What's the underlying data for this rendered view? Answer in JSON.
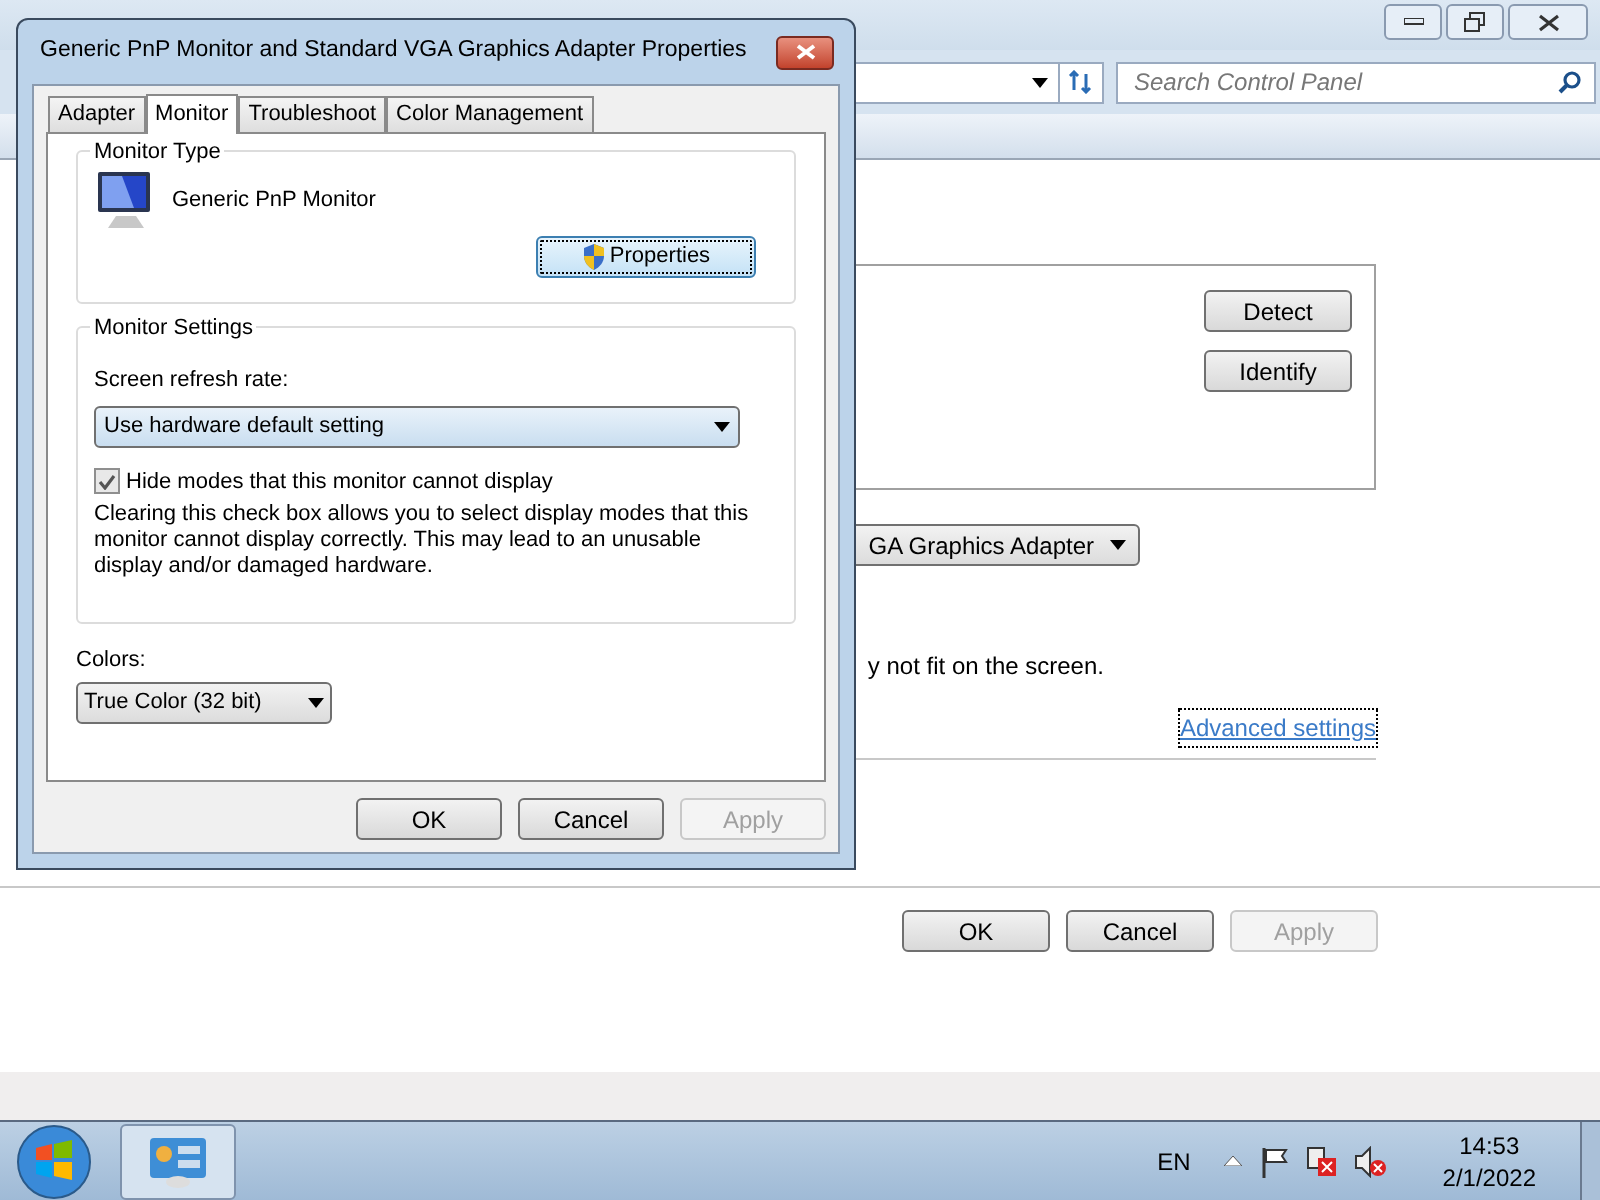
{
  "background_window": {
    "search": {
      "placeholder": "Search Control Panel"
    },
    "detect_button": {
      "label": "Detect"
    },
    "identify_button": {
      "label": "Identify"
    },
    "display_dropdown": {
      "value": "GA Graphics Adapter"
    },
    "note": "y not fit on the screen.",
    "advanced_link": "Advanced settings",
    "buttons": [
      {
        "label": "OK",
        "disabled": false
      },
      {
        "label": "Cancel",
        "disabled": false
      },
      {
        "label": "Apply",
        "disabled": true
      }
    ]
  },
  "dialog": {
    "title": "Generic PnP Monitor and Standard VGA Graphics Adapter Properties",
    "tabs": [
      {
        "label": "Adapter",
        "selected": false
      },
      {
        "label": "Monitor",
        "selected": true
      },
      {
        "label": "Troubleshoot",
        "selected": false
      },
      {
        "label": "Color Management",
        "selected": false
      }
    ],
    "monitor_type": {
      "legend": "Monitor Type",
      "name": "Generic PnP Monitor",
      "properties_button": "Properties"
    },
    "monitor_settings": {
      "legend": "Monitor Settings",
      "refresh_label": "Screen refresh rate:",
      "refresh_value": "Use hardware default setting",
      "hide_modes": {
        "label": "Hide modes that this monitor cannot display",
        "checked": true
      },
      "description": "Clearing this check box allows you to select display modes that this monitor cannot display correctly. This may lead to an unusable display and/or damaged hardware."
    },
    "colors": {
      "label": "Colors:",
      "value": "True Color (32 bit)"
    },
    "buttons": [
      {
        "label": "OK",
        "disabled": false
      },
      {
        "label": "Cancel",
        "disabled": false
      },
      {
        "label": "Apply",
        "disabled": true
      }
    ]
  },
  "taskbar": {
    "language": "EN",
    "time": "14:53",
    "date": "2/1/2022"
  }
}
